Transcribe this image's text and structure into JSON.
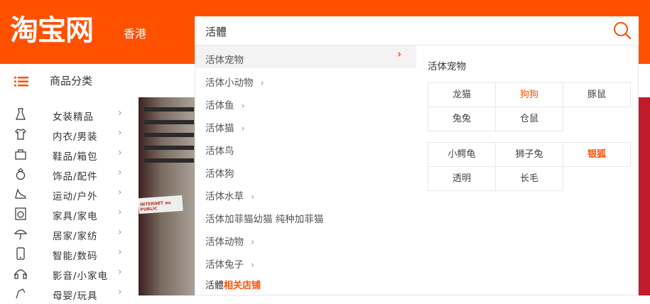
{
  "header": {
    "logo": "淘宝网",
    "region": "香港",
    "search_value": "活體",
    "brand_color": "#ff5000"
  },
  "nav": {
    "category_title": "商品分类",
    "menu_icon": "list-icon"
  },
  "categories": [
    {
      "label": "女装精品",
      "icon": "dress-icon"
    },
    {
      "label": "内衣/男装",
      "icon": "shirt-icon"
    },
    {
      "label": "鞋品/箱包",
      "icon": "bag-icon"
    },
    {
      "label": "饰品/配件",
      "icon": "ring-icon"
    },
    {
      "label": "运动/户外",
      "icon": "heel-icon"
    },
    {
      "label": "家具/家电",
      "icon": "washer-icon"
    },
    {
      "label": "居家/家纺",
      "icon": "umbrella-icon"
    },
    {
      "label": "智能/数码",
      "icon": "phone-icon"
    },
    {
      "label": "影音/小家电",
      "icon": "headphones-icon"
    },
    {
      "label": "母婴/玩具",
      "icon": "toy-icon"
    }
  ],
  "banner": {
    "sign_text": "INTERNET au PUBLIC"
  },
  "suggestions": [
    {
      "label": "活体宠物",
      "has_sub": true,
      "active": true
    },
    {
      "label": "活体小动物",
      "has_sub": true
    },
    {
      "label": "活体鱼",
      "has_sub": true
    },
    {
      "label": "活体猫",
      "has_sub": true
    },
    {
      "label": "活体鸟",
      "has_sub": false
    },
    {
      "label": "活体狗",
      "has_sub": false
    },
    {
      "label": "活体水草",
      "has_sub": true
    },
    {
      "label": "活体加菲猫幼猫 纯种加菲猫",
      "has_sub": false
    },
    {
      "label": "活体动物",
      "has_sub": true
    },
    {
      "label": "活体兔子",
      "has_sub": true
    }
  ],
  "shop_link": {
    "query": "活體",
    "suffix": "相关店铺"
  },
  "panel": {
    "title": "活体宠物",
    "group1": [
      {
        "label": "龙猫",
        "hot": false
      },
      {
        "label": "狗狗",
        "hot": true
      },
      {
        "label": "豚鼠",
        "hot": false
      },
      {
        "label": "兔兔",
        "hot": false
      },
      {
        "label": "仓鼠",
        "hot": false
      }
    ],
    "group2": [
      {
        "label": "小鳄龟",
        "hot": false
      },
      {
        "label": "狮子兔",
        "hot": false
      },
      {
        "label": "银狐",
        "hot": true,
        "bold": true
      },
      {
        "label": "透明",
        "hot": false
      },
      {
        "label": "长毛",
        "hot": false
      }
    ]
  }
}
